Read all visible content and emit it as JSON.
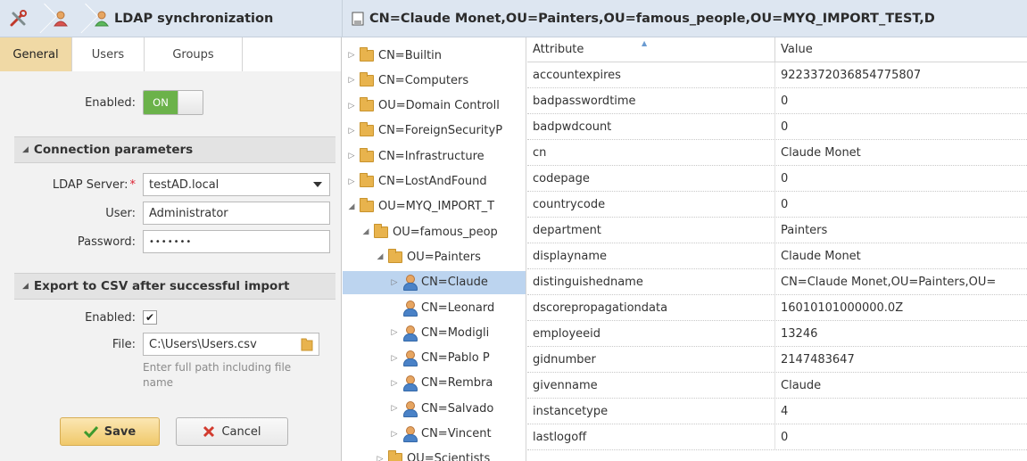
{
  "breadcrumb": {
    "title": "LDAP synchronization"
  },
  "detail": {
    "title": "CN=Claude Monet,OU=Painters,OU=famous_people,OU=MYQ_IMPORT_TEST,D"
  },
  "tabs": [
    {
      "label": "General"
    },
    {
      "label": "Users"
    },
    {
      "label": "Groups"
    }
  ],
  "general": {
    "enabled_label": "Enabled:",
    "toggle_state": "ON",
    "connection": {
      "header": "Connection parameters",
      "server_label": "LDAP Server:",
      "required_mark": "*",
      "server_value": "testAD.local",
      "user_label": "User:",
      "user_value": "Administrator",
      "password_label": "Password:",
      "password_value": "•••••••"
    },
    "export": {
      "header": "Export to CSV after successful import",
      "enabled_label": "Enabled:",
      "enabled_checked": true,
      "check_glyph": "✔",
      "file_label": "File:",
      "file_value": "C:\\Users\\Users.csv",
      "hint": "Enter full path including file name"
    },
    "save_label": "Save",
    "cancel_label": "Cancel"
  },
  "tree": [
    {
      "label": "CN=Builtin",
      "expander": "▷",
      "icon": "folder-icon",
      "level": 0
    },
    {
      "label": "CN=Computers",
      "expander": "▷",
      "icon": "folder-icon",
      "level": 0
    },
    {
      "label": "OU=Domain Controll",
      "expander": "▷",
      "icon": "folder-icon",
      "level": 0
    },
    {
      "label": "CN=ForeignSecurityP",
      "expander": "▷",
      "icon": "folder-icon",
      "level": 0
    },
    {
      "label": "CN=Infrastructure",
      "expander": "▷",
      "icon": "folder-icon",
      "level": 0
    },
    {
      "label": "CN=LostAndFound",
      "expander": "▷",
      "icon": "folder-icon",
      "level": 0
    },
    {
      "label": "OU=MYQ_IMPORT_T",
      "expander": "◢",
      "icon": "folder-icon",
      "level": 0
    },
    {
      "label": "OU=famous_peop",
      "expander": "◢",
      "icon": "folder-icon",
      "level": 1
    },
    {
      "label": "OU=Painters",
      "expander": "◢",
      "icon": "folder-icon",
      "level": 2
    },
    {
      "label": "CN=Claude",
      "expander": "▷",
      "icon": "user-icon",
      "level": 3,
      "selected": true
    },
    {
      "label": "CN=Leonard",
      "expander": "",
      "icon": "user-icon",
      "level": 3
    },
    {
      "label": "CN=Modigli",
      "expander": "▷",
      "icon": "user-icon",
      "level": 3
    },
    {
      "label": "CN=Pablo P",
      "expander": "▷",
      "icon": "user-icon",
      "level": 3
    },
    {
      "label": "CN=Rembra",
      "expander": "▷",
      "icon": "user-icon",
      "level": 3
    },
    {
      "label": "CN=Salvado",
      "expander": "▷",
      "icon": "user-icon",
      "level": 3
    },
    {
      "label": "CN=Vincent",
      "expander": "▷",
      "icon": "user-icon",
      "level": 3
    },
    {
      "label": "OU=Scientists",
      "expander": "▷",
      "icon": "folder-icon",
      "level": 2
    }
  ],
  "attributes": {
    "columns": [
      "Attribute",
      "Value"
    ],
    "rows": [
      [
        "accountexpires",
        "9223372036854775807"
      ],
      [
        "badpasswordtime",
        "0"
      ],
      [
        "badpwdcount",
        "0"
      ],
      [
        "cn",
        "Claude Monet"
      ],
      [
        "codepage",
        "0"
      ],
      [
        "countrycode",
        "0"
      ],
      [
        "department",
        "Painters"
      ],
      [
        "displayname",
        "Claude Monet"
      ],
      [
        "distinguishedname",
        "CN=Claude Monet,OU=Painters,OU="
      ],
      [
        "dscorepropagationdata",
        "16010101000000.0Z"
      ],
      [
        "employeeid",
        "13246"
      ],
      [
        "gidnumber",
        "2147483647"
      ],
      [
        "givenname",
        "Claude"
      ],
      [
        "instancetype",
        "4"
      ],
      [
        "lastlogoff",
        "0"
      ]
    ]
  }
}
